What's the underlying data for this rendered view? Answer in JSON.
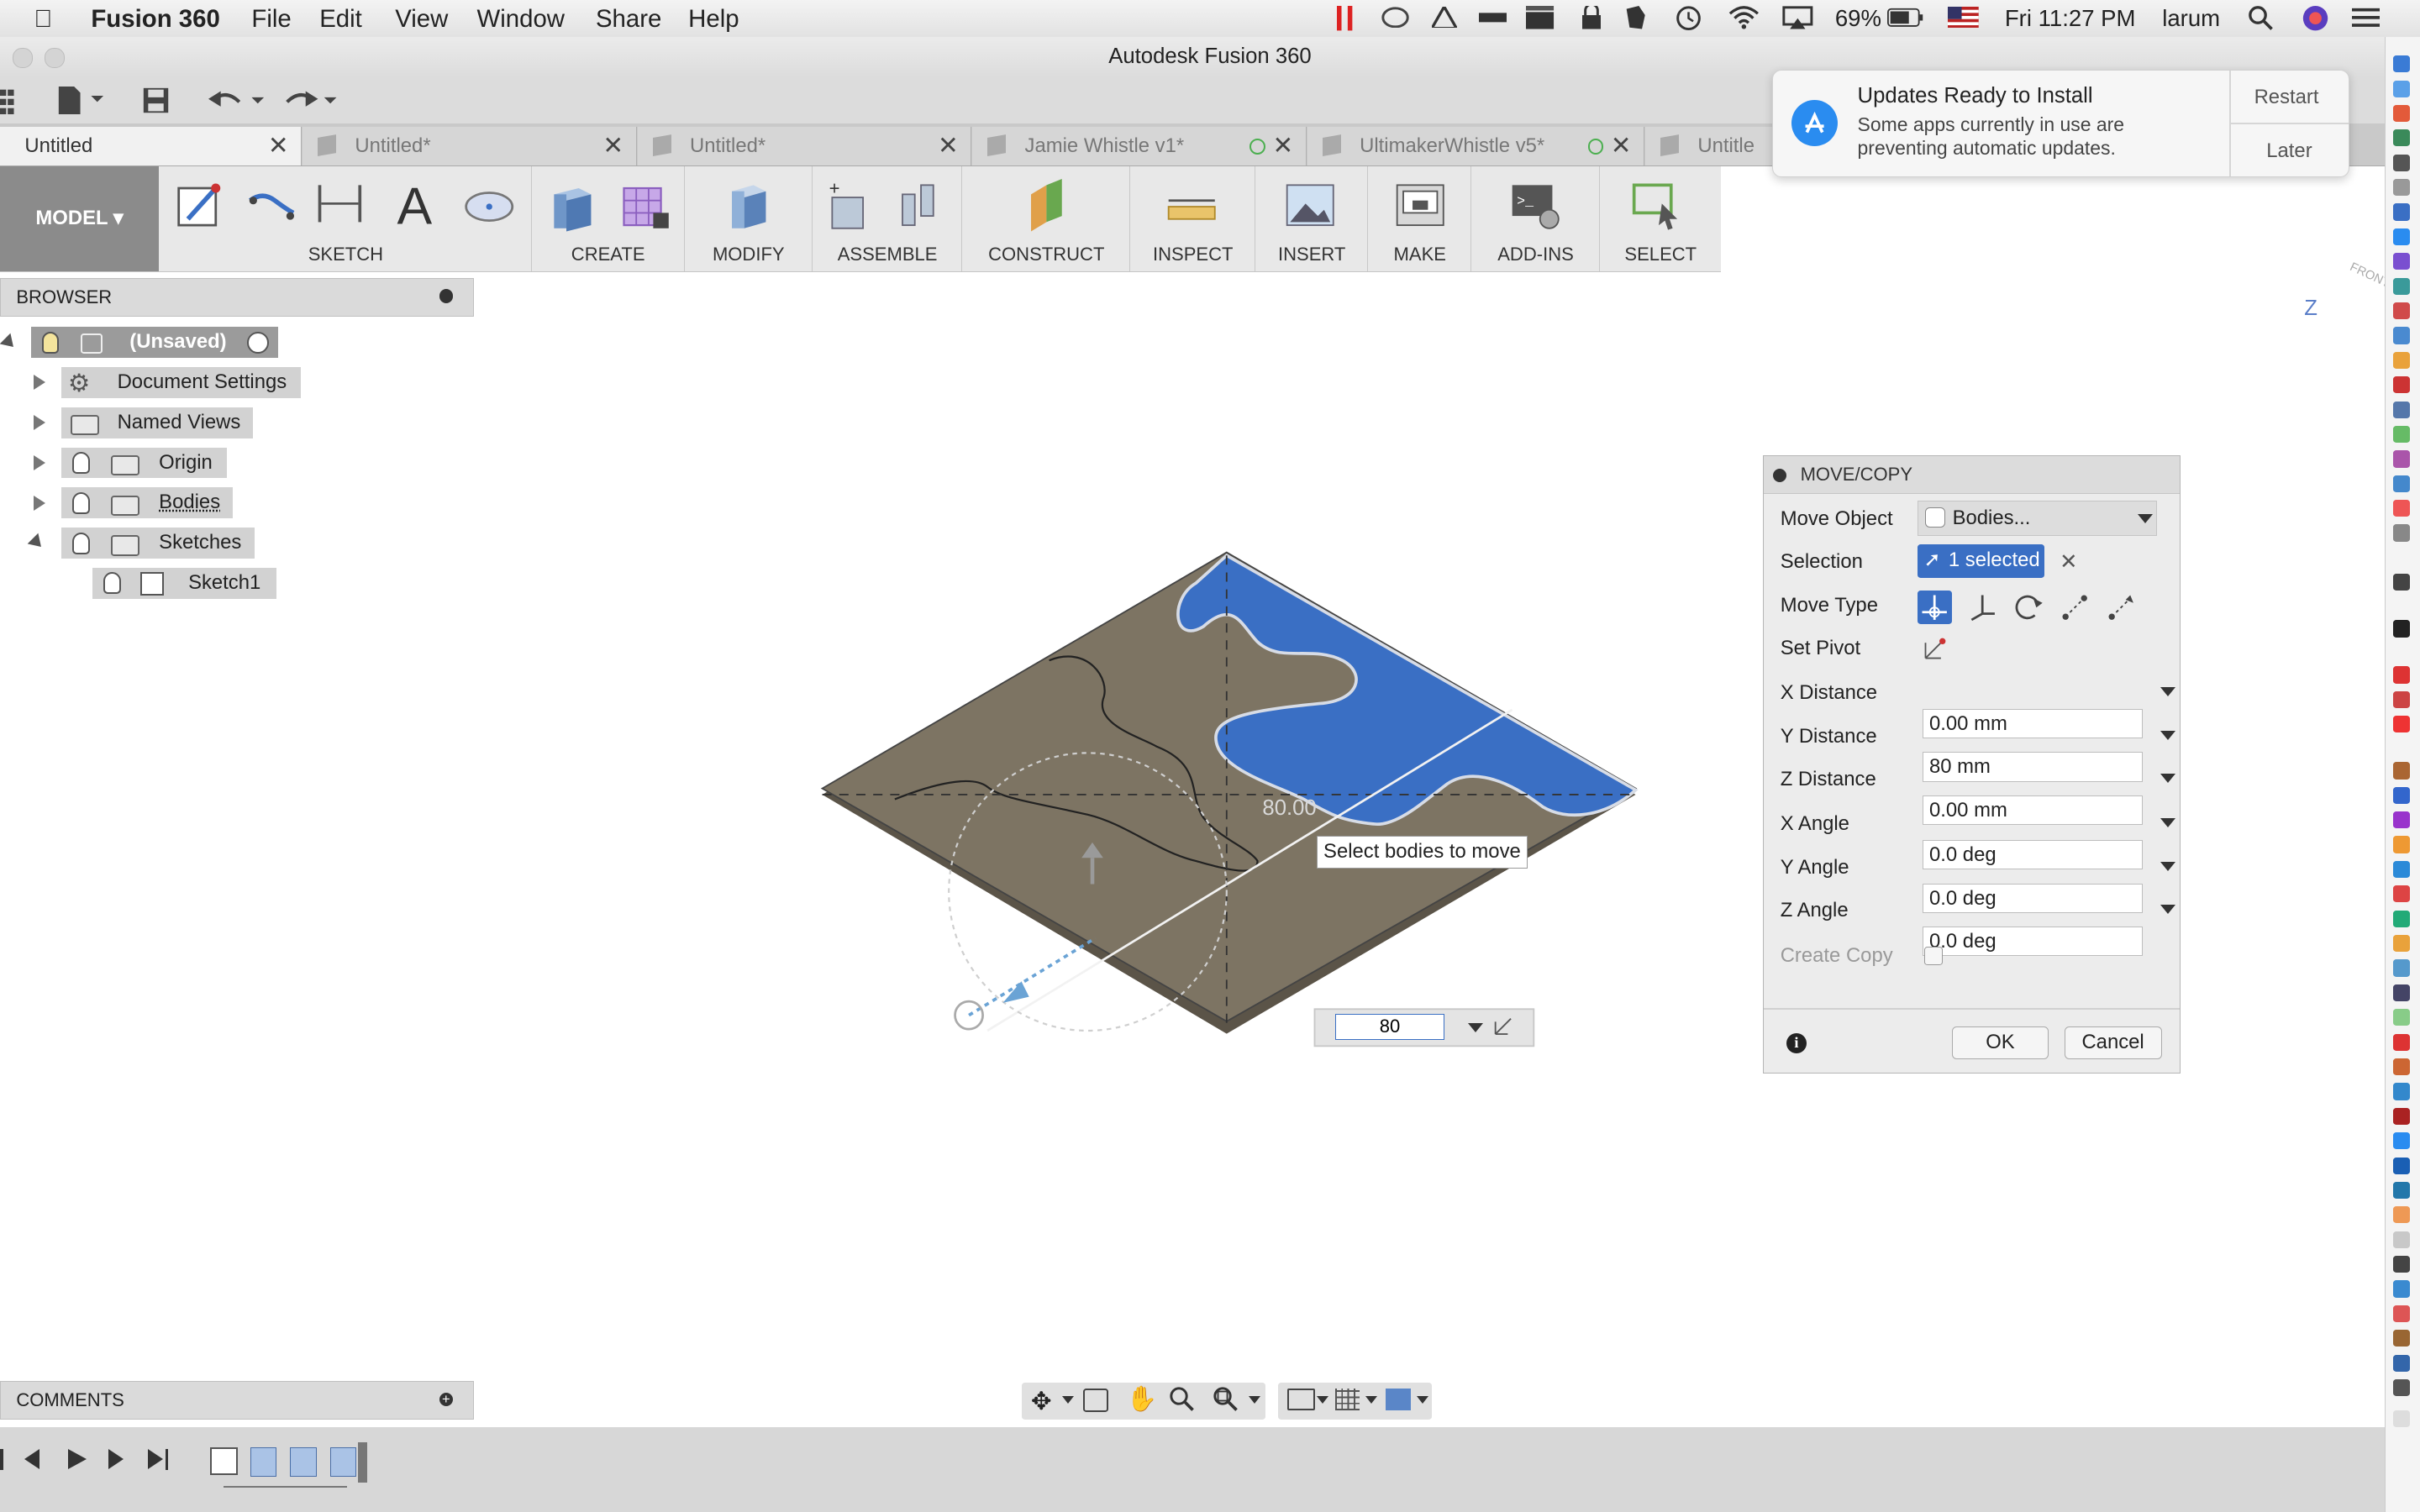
{
  "menubar": {
    "app_name": "Fusion 360",
    "menus": [
      "File",
      "Edit",
      "View",
      "Window",
      "Share",
      "Help"
    ],
    "battery": "69%",
    "clock": "Fri 11:27 PM",
    "user": "larum"
  },
  "window": {
    "title": "Autodesk Fusion 360"
  },
  "tabs": [
    {
      "label": "Untitled",
      "active": true
    },
    {
      "label": "Untitled*",
      "active": false
    },
    {
      "label": "Untitled*",
      "active": false
    },
    {
      "label": "Jamie Whistle v1*",
      "active": false
    },
    {
      "label": "UltimakerWhistle v5*",
      "active": false
    },
    {
      "label": "Untitle",
      "active": false
    }
  ],
  "ribbon": {
    "workspace": "MODEL",
    "groups": [
      "SKETCH",
      "CREATE",
      "MODIFY",
      "ASSEMBLE",
      "CONSTRUCT",
      "INSPECT",
      "INSERT",
      "MAKE",
      "ADD-INS",
      "SELECT"
    ]
  },
  "browser": {
    "title": "BROWSER",
    "root": "(Unsaved)",
    "items": [
      "Document Settings",
      "Named Views",
      "Origin",
      "Bodies",
      "Sketches"
    ],
    "child": "Sketch1"
  },
  "viewport": {
    "dimension_label": "80.00",
    "tooltip": "Select bodies to move",
    "input_value": "80",
    "viewcube_label": "FRONT",
    "axis_label": "Z"
  },
  "dialog": {
    "title": "MOVE/COPY",
    "move_object_label": "Move Object",
    "move_object_value": "Bodies...",
    "selection_label": "Selection",
    "selection_value": "1 selected",
    "move_type_label": "Move Type",
    "set_pivot_label": "Set Pivot",
    "x_distance_label": "X Distance",
    "x_distance_value": "0.00 mm",
    "y_distance_label": "Y Distance",
    "y_distance_value": "80 mm",
    "z_distance_label": "Z Distance",
    "z_distance_value": "0.00 mm",
    "x_angle_label": "X Angle",
    "x_angle_value": "0.0 deg",
    "y_angle_label": "Y Angle",
    "y_angle_value": "0.0 deg",
    "z_angle_label": "Z Angle",
    "z_angle_value": "0.0 deg",
    "create_copy_label": "Create Copy",
    "ok": "OK",
    "cancel": "Cancel"
  },
  "notification": {
    "title": "Updates Ready to Install",
    "body": "Some apps currently in use are preventing automatic updates.",
    "restart": "Restart",
    "later": "Later"
  },
  "comments": {
    "title": "COMMENTS"
  },
  "colors": {
    "selection_blue": "#3a6fc4",
    "body_brown": "#7d7463",
    "ribbon_model": "#8b8b8b"
  }
}
